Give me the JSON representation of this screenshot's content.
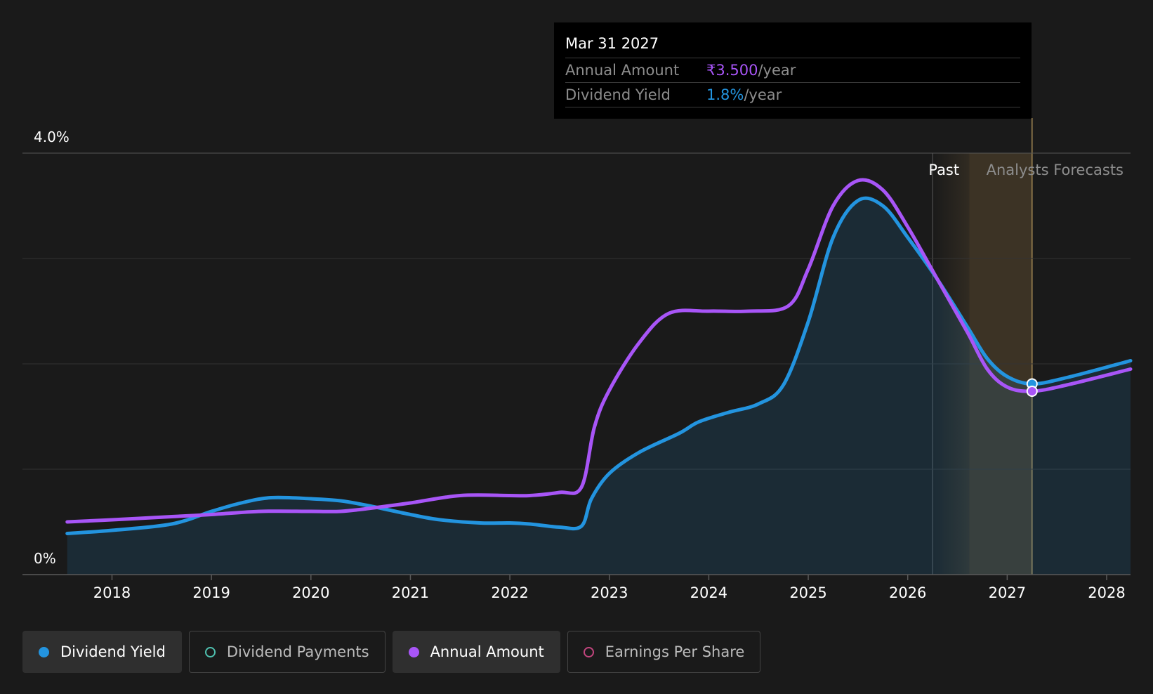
{
  "tooltip": {
    "date": "Mar 31 2027",
    "rows": [
      {
        "label": "Annual Amount",
        "value": "₹3.500",
        "unit": "/year",
        "color": "#a855f7"
      },
      {
        "label": "Dividend Yield",
        "value": "1.8%",
        "unit": "/year",
        "color": "#2394df"
      }
    ]
  },
  "regions": {
    "past_label": "Past",
    "forecast_label": "Analysts Forecasts"
  },
  "legend": [
    {
      "label": "Dividend Yield",
      "color": "#2394df",
      "filled": true,
      "active": true
    },
    {
      "label": "Dividend Payments",
      "color": "#4fc1b0",
      "filled": false,
      "active": false
    },
    {
      "label": "Annual Amount",
      "color": "#a855f7",
      "filled": true,
      "active": true
    },
    {
      "label": "Earnings Per Share",
      "color": "#c2457e",
      "filled": false,
      "active": false
    }
  ],
  "chart_data": {
    "type": "line",
    "y_tick_labels": [
      "0%",
      "4.0%"
    ],
    "ylim": [
      0,
      4.0
    ],
    "xlim": [
      2017.1,
      2028.24
    ],
    "x_tick_labels": [
      "2018",
      "2019",
      "2020",
      "2021",
      "2022",
      "2023",
      "2024",
      "2025",
      "2026",
      "2027",
      "2028"
    ],
    "past_end": 2026.25,
    "forecast_start": 2026.62,
    "highlight_x": 2027.25,
    "grid": true,
    "series": [
      {
        "name": "Dividend Yield",
        "color": "#2394df",
        "area": true,
        "points": [
          [
            2017.55,
            0.39
          ],
          [
            2018.0,
            0.42
          ],
          [
            2018.6,
            0.48
          ],
          [
            2019.0,
            0.6
          ],
          [
            2019.3,
            0.68
          ],
          [
            2019.6,
            0.73
          ],
          [
            2020.0,
            0.72
          ],
          [
            2020.3,
            0.7
          ],
          [
            2020.6,
            0.65
          ],
          [
            2021.0,
            0.57
          ],
          [
            2021.3,
            0.52
          ],
          [
            2021.7,
            0.49
          ],
          [
            2022.0,
            0.49
          ],
          [
            2022.2,
            0.48
          ],
          [
            2022.5,
            0.45
          ],
          [
            2022.72,
            0.46
          ],
          [
            2022.82,
            0.72
          ],
          [
            2023.0,
            0.96
          ],
          [
            2023.3,
            1.16
          ],
          [
            2023.7,
            1.34
          ],
          [
            2023.9,
            1.45
          ],
          [
            2024.2,
            1.54
          ],
          [
            2024.5,
            1.62
          ],
          [
            2024.75,
            1.8
          ],
          [
            2025.0,
            2.4
          ],
          [
            2025.25,
            3.2
          ],
          [
            2025.5,
            3.55
          ],
          [
            2025.75,
            3.5
          ],
          [
            2026.0,
            3.2
          ],
          [
            2026.3,
            2.8
          ],
          [
            2026.6,
            2.35
          ],
          [
            2026.8,
            2.05
          ],
          [
            2027.0,
            1.88
          ],
          [
            2027.25,
            1.81
          ],
          [
            2027.6,
            1.87
          ],
          [
            2028.24,
            2.03
          ]
        ]
      },
      {
        "name": "Annual Amount",
        "color": "#a855f7",
        "area": false,
        "points": [
          [
            2017.55,
            0.5
          ],
          [
            2018.0,
            0.52
          ],
          [
            2018.6,
            0.55
          ],
          [
            2019.0,
            0.57
          ],
          [
            2019.5,
            0.6
          ],
          [
            2020.0,
            0.6
          ],
          [
            2020.3,
            0.6
          ],
          [
            2020.6,
            0.63
          ],
          [
            2021.0,
            0.68
          ],
          [
            2021.5,
            0.75
          ],
          [
            2022.0,
            0.75
          ],
          [
            2022.2,
            0.75
          ],
          [
            2022.5,
            0.78
          ],
          [
            2022.72,
            0.83
          ],
          [
            2022.85,
            1.4
          ],
          [
            2023.0,
            1.75
          ],
          [
            2023.3,
            2.2
          ],
          [
            2023.6,
            2.48
          ],
          [
            2024.0,
            2.5
          ],
          [
            2024.4,
            2.5
          ],
          [
            2024.8,
            2.55
          ],
          [
            2025.0,
            2.9
          ],
          [
            2025.25,
            3.5
          ],
          [
            2025.5,
            3.74
          ],
          [
            2025.75,
            3.65
          ],
          [
            2026.0,
            3.3
          ],
          [
            2026.3,
            2.8
          ],
          [
            2026.6,
            2.3
          ],
          [
            2026.8,
            1.95
          ],
          [
            2027.0,
            1.78
          ],
          [
            2027.25,
            1.74
          ],
          [
            2027.6,
            1.8
          ],
          [
            2028.24,
            1.95
          ]
        ]
      }
    ]
  }
}
